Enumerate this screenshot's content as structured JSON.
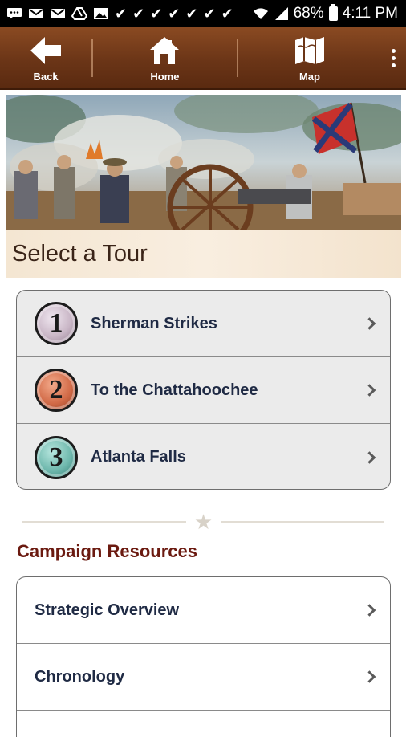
{
  "status_bar": {
    "battery": "68%",
    "time": "4:11 PM"
  },
  "nav": {
    "back_label": "Back",
    "home_label": "Home",
    "map_label": "Map"
  },
  "hero": {
    "heading": "Select a Tour"
  },
  "tours": [
    {
      "number": "1",
      "label": "Sherman Strikes"
    },
    {
      "number": "2",
      "label": "To the Chattahoochee"
    },
    {
      "number": "3",
      "label": "Atlanta Falls"
    }
  ],
  "resources": {
    "title": "Campaign Resources",
    "items": [
      {
        "label": "Strategic Overview"
      },
      {
        "label": "Chronology"
      }
    ]
  },
  "colors": {
    "nav_brown": "#6b3517",
    "section_title": "#6b1a10",
    "list_text": "#1f2a44"
  }
}
